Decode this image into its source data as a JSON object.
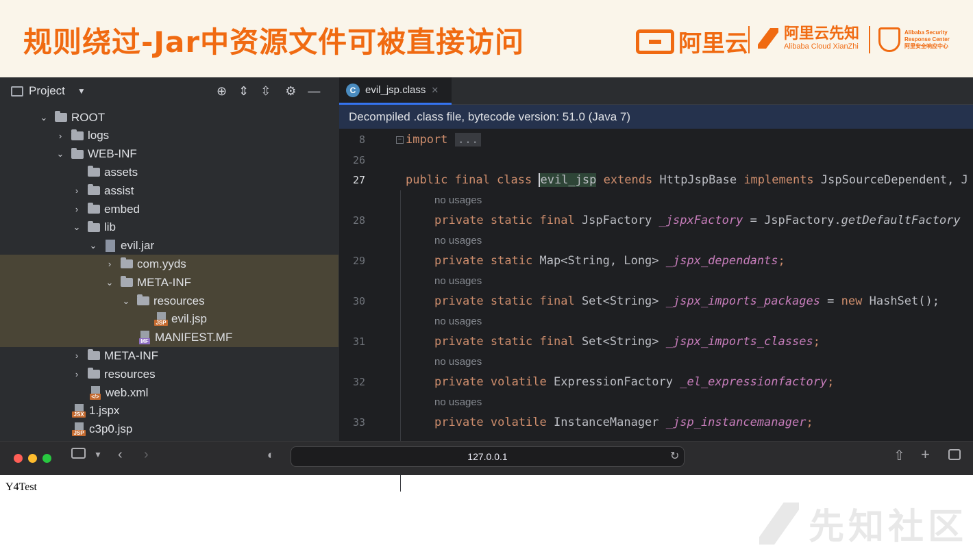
{
  "slide": {
    "title": "规则绕过-Jar中资源文件可被直接访问",
    "logos": {
      "aliyun": "阿里云",
      "xianzhi_cn": "阿里云先知",
      "xianzhi_en": "Alibaba Cloud XianZhi",
      "asrc_line1": "Alibaba Security",
      "asrc_line2": "Response Center",
      "asrc_line3": "阿里安全响应中心"
    }
  },
  "ide": {
    "project_title": "Project",
    "tree": [
      {
        "label": "ROOT",
        "type": "folder",
        "expanded": true
      },
      {
        "label": "logs",
        "type": "folder",
        "expanded": false
      },
      {
        "label": "WEB-INF",
        "type": "folder",
        "expanded": true
      },
      {
        "label": "assets",
        "type": "folder",
        "expanded": null
      },
      {
        "label": "assist",
        "type": "folder",
        "expanded": false
      },
      {
        "label": "embed",
        "type": "folder",
        "expanded": false
      },
      {
        "label": "lib",
        "type": "folder",
        "expanded": true
      },
      {
        "label": "evil.jar",
        "type": "jar",
        "expanded": true
      },
      {
        "label": "com.yyds",
        "type": "folder",
        "expanded": false
      },
      {
        "label": "META-INF",
        "type": "folder",
        "expanded": true
      },
      {
        "label": "resources",
        "type": "folder",
        "expanded": true
      },
      {
        "label": "evil.jsp",
        "type": "jsp",
        "badge": "JSP"
      },
      {
        "label": "MANIFEST.MF",
        "type": "mf",
        "badge": "MF"
      },
      {
        "label": "META-INF",
        "type": "folder",
        "expanded": false
      },
      {
        "label": "resources",
        "type": "folder",
        "expanded": false
      },
      {
        "label": "web.xml",
        "type": "xml",
        "badge": "</>"
      },
      {
        "label": "1.jspx",
        "type": "jspx",
        "badge": "JSX"
      },
      {
        "label": "c3p0.jsp",
        "type": "jsp",
        "badge": "JSP"
      }
    ],
    "editor": {
      "tab_label": "evil_jsp.class",
      "banner": "Decompiled .class file, bytecode version: 51.0 (Java 7)",
      "no_usages": "no usages",
      "lines": {
        "l8": {
          "num": "8",
          "kw": "import",
          "rest": "..."
        },
        "l26": {
          "num": "26"
        },
        "l27": {
          "num": "27",
          "kw1": "public final class ",
          "cls": "evil_jsp",
          "kw2": " extends ",
          "t1": "HttpJspBase",
          "kw3": " implements ",
          "t2": "JspSourceDependent, J"
        },
        "l28": {
          "num": "28",
          "kw": "private static final ",
          "type": "JspFactory ",
          "field": "_jspxFactory",
          "op": " = JspFactory.",
          "fn": "getDefaultFactory"
        },
        "l29": {
          "num": "29",
          "kw": "private static ",
          "type": "Map<String, Long> ",
          "field": "_jspx_dependants",
          "end": ";"
        },
        "l30": {
          "num": "30",
          "kw": "private static final ",
          "type": "Set<String> ",
          "field": "_jspx_imports_packages",
          "op": " = ",
          "kw2": "new",
          "end": " HashSet();"
        },
        "l31": {
          "num": "31",
          "kw": "private static final ",
          "type": "Set<String> ",
          "field": "_jspx_imports_classes",
          "end": ";"
        },
        "l32": {
          "num": "32",
          "kw": "private volatile ",
          "type": "ExpressionFactory ",
          "field": "_el_expressionfactory",
          "end": ";"
        },
        "l33": {
          "num": "33",
          "kw": "private volatile ",
          "type": "InstanceManager ",
          "field": "_jsp_instancemanager",
          "end": ";"
        }
      }
    }
  },
  "browser": {
    "url": "127.0.0.1",
    "page_text": "Y4Test"
  },
  "watermark": "先知社区",
  "colors": {
    "accent": "#f06a11",
    "keyword": "#cf8e6d",
    "field": "#c77dbb",
    "selection_highlight": "#4a4536",
    "tab_underline": "#3574f0"
  }
}
